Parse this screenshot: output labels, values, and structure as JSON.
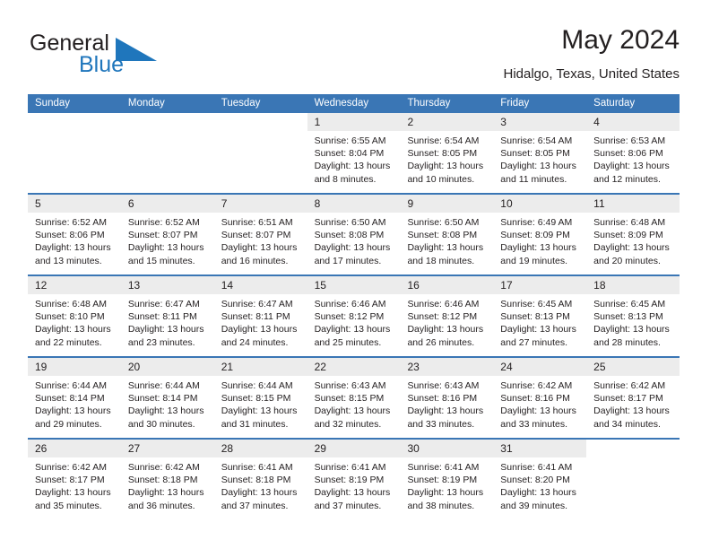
{
  "brand": {
    "name_primary": "General",
    "name_secondary": "Blue",
    "color_primary": "#231f20",
    "color_secondary": "#1f76bc",
    "triangle_icon": "blue-triangle-icon"
  },
  "header": {
    "title": "May 2024",
    "subtitle": "Hidalgo, Texas, United States"
  },
  "theme": {
    "header_bar": "#3a76b5",
    "row_divider": "#3a76b5",
    "day_band": "#ececec",
    "text": "#231f20"
  },
  "weekdays": [
    "Sunday",
    "Monday",
    "Tuesday",
    "Wednesday",
    "Thursday",
    "Friday",
    "Saturday"
  ],
  "labels": {
    "sunrise_prefix": "Sunrise:",
    "sunset_prefix": "Sunset:",
    "daylight_prefix": "Daylight:"
  },
  "weeks": [
    [
      {
        "empty": true
      },
      {
        "empty": true
      },
      {
        "empty": true
      },
      {
        "day": "1",
        "sunrise": "Sunrise: 6:55 AM",
        "sunset": "Sunset: 8:04 PM",
        "daylight_l1": "Daylight: 13 hours",
        "daylight_l2": "and 8 minutes."
      },
      {
        "day": "2",
        "sunrise": "Sunrise: 6:54 AM",
        "sunset": "Sunset: 8:05 PM",
        "daylight_l1": "Daylight: 13 hours",
        "daylight_l2": "and 10 minutes."
      },
      {
        "day": "3",
        "sunrise": "Sunrise: 6:54 AM",
        "sunset": "Sunset: 8:05 PM",
        "daylight_l1": "Daylight: 13 hours",
        "daylight_l2": "and 11 minutes."
      },
      {
        "day": "4",
        "sunrise": "Sunrise: 6:53 AM",
        "sunset": "Sunset: 8:06 PM",
        "daylight_l1": "Daylight: 13 hours",
        "daylight_l2": "and 12 minutes."
      }
    ],
    [
      {
        "day": "5",
        "sunrise": "Sunrise: 6:52 AM",
        "sunset": "Sunset: 8:06 PM",
        "daylight_l1": "Daylight: 13 hours",
        "daylight_l2": "and 13 minutes."
      },
      {
        "day": "6",
        "sunrise": "Sunrise: 6:52 AM",
        "sunset": "Sunset: 8:07 PM",
        "daylight_l1": "Daylight: 13 hours",
        "daylight_l2": "and 15 minutes."
      },
      {
        "day": "7",
        "sunrise": "Sunrise: 6:51 AM",
        "sunset": "Sunset: 8:07 PM",
        "daylight_l1": "Daylight: 13 hours",
        "daylight_l2": "and 16 minutes."
      },
      {
        "day": "8",
        "sunrise": "Sunrise: 6:50 AM",
        "sunset": "Sunset: 8:08 PM",
        "daylight_l1": "Daylight: 13 hours",
        "daylight_l2": "and 17 minutes."
      },
      {
        "day": "9",
        "sunrise": "Sunrise: 6:50 AM",
        "sunset": "Sunset: 8:08 PM",
        "daylight_l1": "Daylight: 13 hours",
        "daylight_l2": "and 18 minutes."
      },
      {
        "day": "10",
        "sunrise": "Sunrise: 6:49 AM",
        "sunset": "Sunset: 8:09 PM",
        "daylight_l1": "Daylight: 13 hours",
        "daylight_l2": "and 19 minutes."
      },
      {
        "day": "11",
        "sunrise": "Sunrise: 6:48 AM",
        "sunset": "Sunset: 8:09 PM",
        "daylight_l1": "Daylight: 13 hours",
        "daylight_l2": "and 20 minutes."
      }
    ],
    [
      {
        "day": "12",
        "sunrise": "Sunrise: 6:48 AM",
        "sunset": "Sunset: 8:10 PM",
        "daylight_l1": "Daylight: 13 hours",
        "daylight_l2": "and 22 minutes."
      },
      {
        "day": "13",
        "sunrise": "Sunrise: 6:47 AM",
        "sunset": "Sunset: 8:11 PM",
        "daylight_l1": "Daylight: 13 hours",
        "daylight_l2": "and 23 minutes."
      },
      {
        "day": "14",
        "sunrise": "Sunrise: 6:47 AM",
        "sunset": "Sunset: 8:11 PM",
        "daylight_l1": "Daylight: 13 hours",
        "daylight_l2": "and 24 minutes."
      },
      {
        "day": "15",
        "sunrise": "Sunrise: 6:46 AM",
        "sunset": "Sunset: 8:12 PM",
        "daylight_l1": "Daylight: 13 hours",
        "daylight_l2": "and 25 minutes."
      },
      {
        "day": "16",
        "sunrise": "Sunrise: 6:46 AM",
        "sunset": "Sunset: 8:12 PM",
        "daylight_l1": "Daylight: 13 hours",
        "daylight_l2": "and 26 minutes."
      },
      {
        "day": "17",
        "sunrise": "Sunrise: 6:45 AM",
        "sunset": "Sunset: 8:13 PM",
        "daylight_l1": "Daylight: 13 hours",
        "daylight_l2": "and 27 minutes."
      },
      {
        "day": "18",
        "sunrise": "Sunrise: 6:45 AM",
        "sunset": "Sunset: 8:13 PM",
        "daylight_l1": "Daylight: 13 hours",
        "daylight_l2": "and 28 minutes."
      }
    ],
    [
      {
        "day": "19",
        "sunrise": "Sunrise: 6:44 AM",
        "sunset": "Sunset: 8:14 PM",
        "daylight_l1": "Daylight: 13 hours",
        "daylight_l2": "and 29 minutes."
      },
      {
        "day": "20",
        "sunrise": "Sunrise: 6:44 AM",
        "sunset": "Sunset: 8:14 PM",
        "daylight_l1": "Daylight: 13 hours",
        "daylight_l2": "and 30 minutes."
      },
      {
        "day": "21",
        "sunrise": "Sunrise: 6:44 AM",
        "sunset": "Sunset: 8:15 PM",
        "daylight_l1": "Daylight: 13 hours",
        "daylight_l2": "and 31 minutes."
      },
      {
        "day": "22",
        "sunrise": "Sunrise: 6:43 AM",
        "sunset": "Sunset: 8:15 PM",
        "daylight_l1": "Daylight: 13 hours",
        "daylight_l2": "and 32 minutes."
      },
      {
        "day": "23",
        "sunrise": "Sunrise: 6:43 AM",
        "sunset": "Sunset: 8:16 PM",
        "daylight_l1": "Daylight: 13 hours",
        "daylight_l2": "and 33 minutes."
      },
      {
        "day": "24",
        "sunrise": "Sunrise: 6:42 AM",
        "sunset": "Sunset: 8:16 PM",
        "daylight_l1": "Daylight: 13 hours",
        "daylight_l2": "and 33 minutes."
      },
      {
        "day": "25",
        "sunrise": "Sunrise: 6:42 AM",
        "sunset": "Sunset: 8:17 PM",
        "daylight_l1": "Daylight: 13 hours",
        "daylight_l2": "and 34 minutes."
      }
    ],
    [
      {
        "day": "26",
        "sunrise": "Sunrise: 6:42 AM",
        "sunset": "Sunset: 8:17 PM",
        "daylight_l1": "Daylight: 13 hours",
        "daylight_l2": "and 35 minutes."
      },
      {
        "day": "27",
        "sunrise": "Sunrise: 6:42 AM",
        "sunset": "Sunset: 8:18 PM",
        "daylight_l1": "Daylight: 13 hours",
        "daylight_l2": "and 36 minutes."
      },
      {
        "day": "28",
        "sunrise": "Sunrise: 6:41 AM",
        "sunset": "Sunset: 8:18 PM",
        "daylight_l1": "Daylight: 13 hours",
        "daylight_l2": "and 37 minutes."
      },
      {
        "day": "29",
        "sunrise": "Sunrise: 6:41 AM",
        "sunset": "Sunset: 8:19 PM",
        "daylight_l1": "Daylight: 13 hours",
        "daylight_l2": "and 37 minutes."
      },
      {
        "day": "30",
        "sunrise": "Sunrise: 6:41 AM",
        "sunset": "Sunset: 8:19 PM",
        "daylight_l1": "Daylight: 13 hours",
        "daylight_l2": "and 38 minutes."
      },
      {
        "day": "31",
        "sunrise": "Sunrise: 6:41 AM",
        "sunset": "Sunset: 8:20 PM",
        "daylight_l1": "Daylight: 13 hours",
        "daylight_l2": "and 39 minutes."
      },
      {
        "empty": true
      }
    ]
  ]
}
